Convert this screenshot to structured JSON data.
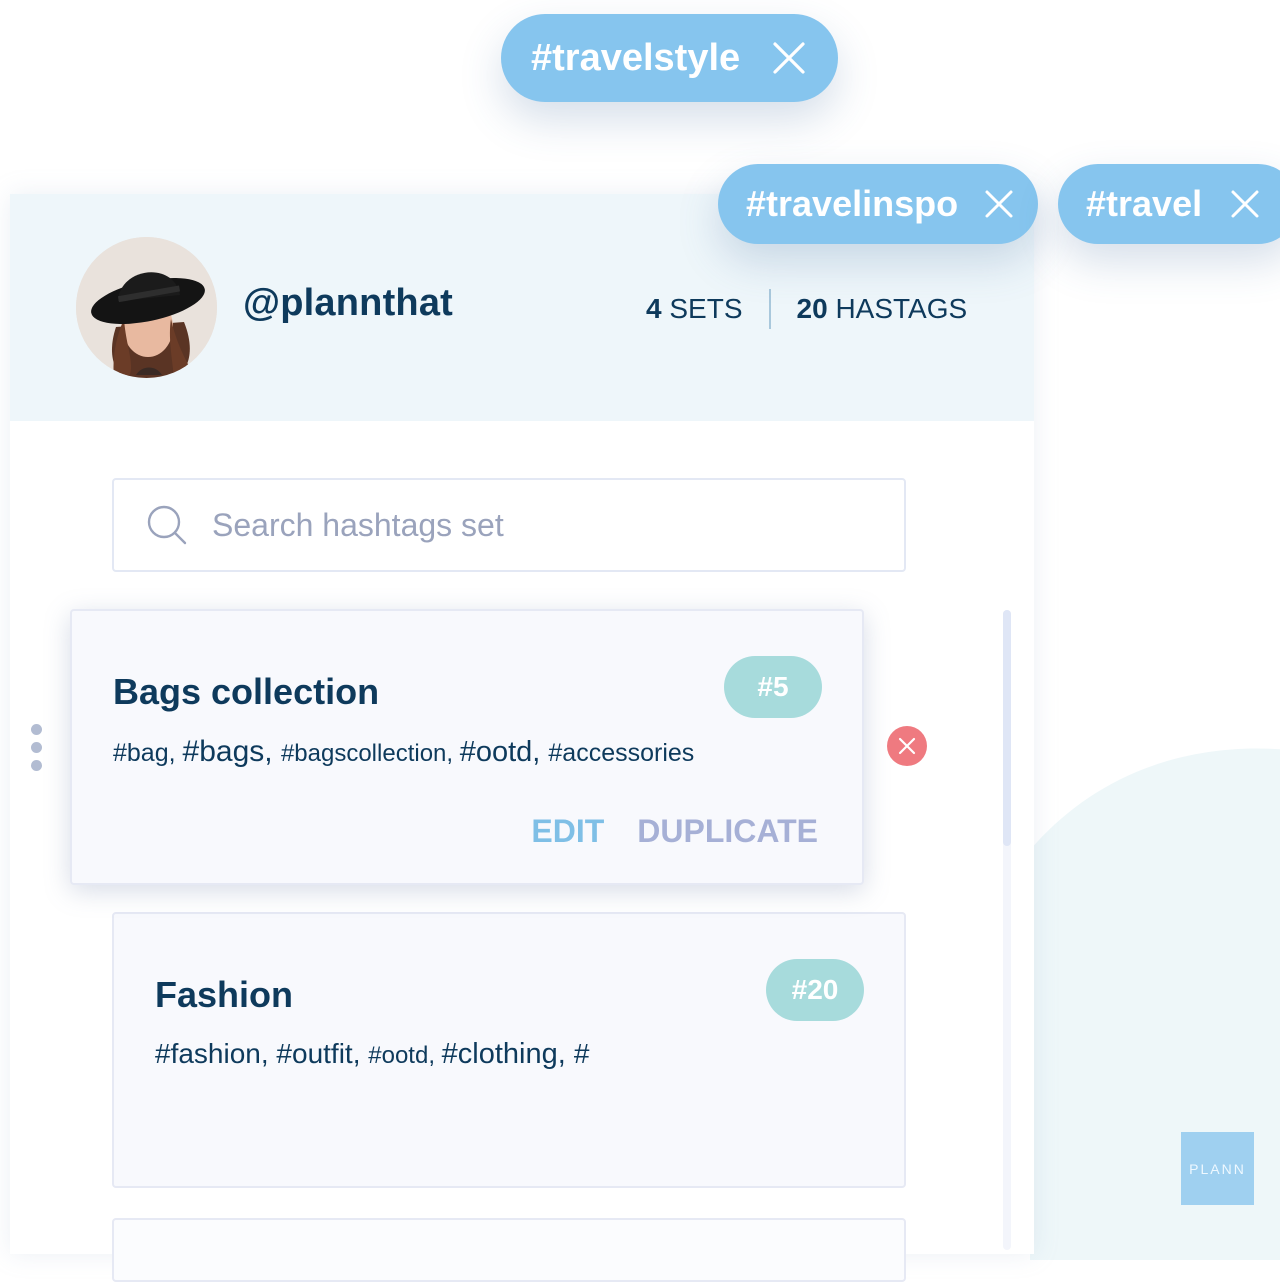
{
  "hashtag_chips": [
    {
      "label": "#travelstyle",
      "close_icon": "close-icon"
    },
    {
      "label": "#travelinspo",
      "close_icon": "close-icon"
    },
    {
      "label": "#travel",
      "close_icon": "close-icon"
    }
  ],
  "profile": {
    "handle": "@plannthat",
    "sets_count": "4",
    "sets_label": "SETS",
    "hashtags_count": "20",
    "hashtags_label": "HASTAGS"
  },
  "search": {
    "placeholder": "Search hashtags set",
    "value": ""
  },
  "sets": [
    {
      "title": "Bags collection",
      "badge": "#5",
      "tags": [
        "#bag, ",
        "#bags, ",
        "#bagscollection, ",
        "#ootd, ",
        "#accessories"
      ],
      "edit_label": "EDIT",
      "duplicate_label": "DUPLICATE"
    },
    {
      "title": "Fashion",
      "badge": "#20",
      "tags": [
        "#fashion, ",
        "#outfit, ",
        "#ootd, ",
        "#clothing, ",
        "#"
      ]
    }
  ],
  "brand": "PLANN",
  "colors": {
    "primary_text": "#0e3a5c",
    "chip": "#86c5ee",
    "badge": "#a7dbdc",
    "edit": "#7fbfe6",
    "duplicate": "#a6b0d6",
    "delete": "#ef7a80",
    "header_bg": "#eef6fa"
  }
}
